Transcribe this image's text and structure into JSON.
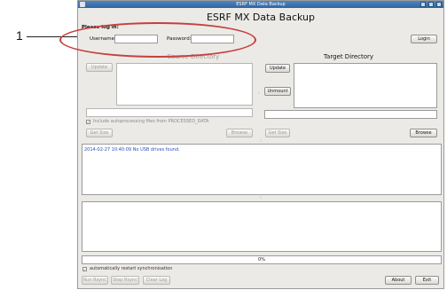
{
  "window": {
    "title": "ESRF MX Data Backup"
  },
  "app": {
    "title": "ESRF MX Data Backup"
  },
  "login": {
    "heading": "Please log in:",
    "username_label": "Username:",
    "username_value": "",
    "password_label": "Password:",
    "password_value": "",
    "login_label": "Login"
  },
  "source": {
    "title": "Source Directory",
    "update_label": "Update",
    "browse_label": "Browse",
    "getsize_label": "Get Size",
    "include_label": "Include autoprocessing files from PROCESSED_DATA",
    "include_checked": true
  },
  "target": {
    "title": "Target Directory",
    "update_label": "Update",
    "unmount_label": "Unmount",
    "browse_label": "Browse",
    "getsize_label": "Get Size"
  },
  "log": {
    "line1": "2014-02-27 10:40:09   No USB drives found."
  },
  "progress": {
    "text": "0%",
    "value": 0
  },
  "footer": {
    "auto_restart_label": "automatically restart synchronisation",
    "auto_restart_checked": true,
    "run_label": "Run Rsync",
    "stop_label": "Stop Rsync",
    "clear_label": "Clear Log",
    "about_label": "About",
    "exit_label": "Exit"
  },
  "annotation": {
    "number": "1"
  },
  "colors": {
    "titlebar": "#2f64a2",
    "highlight": "#c63f3f",
    "log_text": "#2b4fbf"
  }
}
